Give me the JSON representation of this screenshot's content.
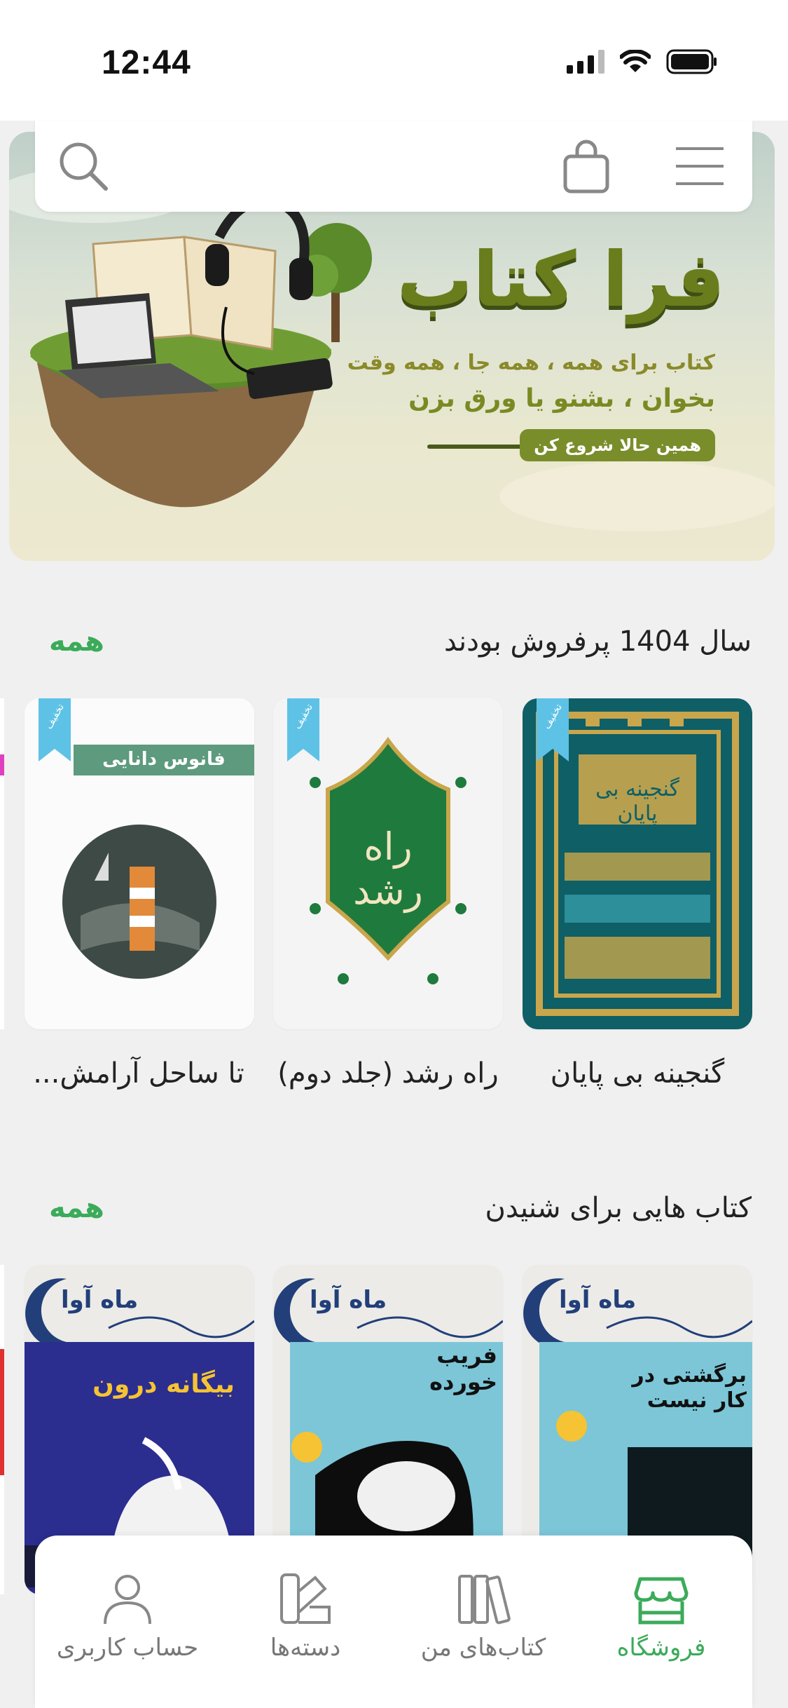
{
  "status_bar": {
    "time": "12:44"
  },
  "banner": {
    "title": "فرا کتاب",
    "line1": "کتاب برای همه ، همه جا ، همه وقت",
    "line2": "بخوان ، بشنو یا ورق بزن",
    "cta": "همین حالا شروع کن"
  },
  "toolbar": {
    "search_icon": "search-icon",
    "cart_icon": "shopping-bag-icon",
    "menu_icon": "hamburger-menu-icon"
  },
  "bestsellers": {
    "title": "سال 1404 پرفروش بودند",
    "more": "همه",
    "discount_label": "تخفیف",
    "books": [
      {
        "title": "گنجینه بی پایان",
        "cover_text": "گنجینه بی پایان"
      },
      {
        "title": "راه رشد (جلد دوم)",
        "cover_text": "راه رشد"
      },
      {
        "title": "تا ساحل آرامش...",
        "cover_text": "فانوس دانایی"
      }
    ]
  },
  "audiobooks": {
    "title": "کتاب هایی برای شنیدن",
    "more": "همه",
    "publisher": "ماه آوا",
    "books": [
      {
        "cover_title": "برگشتی در کار نیست"
      },
      {
        "cover_title": "فریب خورده"
      },
      {
        "cover_title": "بیگانه درون"
      }
    ]
  },
  "bottom_nav": {
    "items": [
      {
        "label": "فروشگاه",
        "icon": "store-icon",
        "active": true
      },
      {
        "label": "کتاب‌های من",
        "icon": "books-icon",
        "active": false
      },
      {
        "label": "دسته‌ها",
        "icon": "categories-icon",
        "active": false
      },
      {
        "label": "حساب کاربری",
        "icon": "user-icon",
        "active": false
      }
    ]
  },
  "colors": {
    "accent": "#3bab5a",
    "background": "#f0f0f1"
  }
}
